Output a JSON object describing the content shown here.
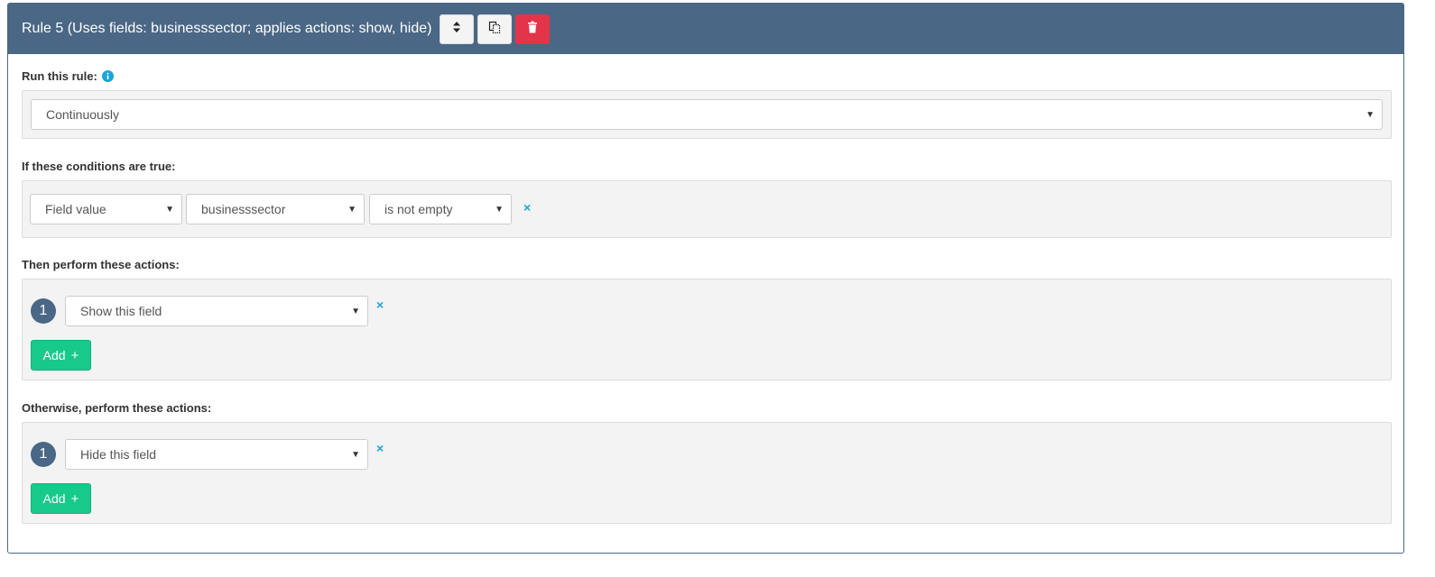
{
  "rule": {
    "title": "Rule 5 (Uses fields: businesssector; applies actions: show, hide)",
    "buttons": {
      "reorder_icon": "sort-icon",
      "copy_icon": "copy-icon",
      "delete_icon": "trash-icon"
    }
  },
  "run_section": {
    "label": "Run this rule:",
    "info_icon": "info-icon",
    "select_value": "Continuously"
  },
  "conditions_section": {
    "label": "If these conditions are true:",
    "condition": {
      "type": "Field value",
      "field": "businesssector",
      "operator": "is not empty",
      "remove": "×"
    }
  },
  "actions_section": {
    "label": "Then perform these actions:",
    "items": [
      {
        "number": "1",
        "value": "Show this field",
        "remove": "×"
      }
    ],
    "add_label": "Add"
  },
  "else_section": {
    "label": "Otherwise, perform these actions:",
    "items": [
      {
        "number": "1",
        "value": "Hide this field",
        "remove": "×"
      }
    ],
    "add_label": "Add"
  },
  "colors": {
    "header": "#4a6785",
    "danger": "#e3344a",
    "success": "#18c98c",
    "link": "#1aa5d6"
  }
}
